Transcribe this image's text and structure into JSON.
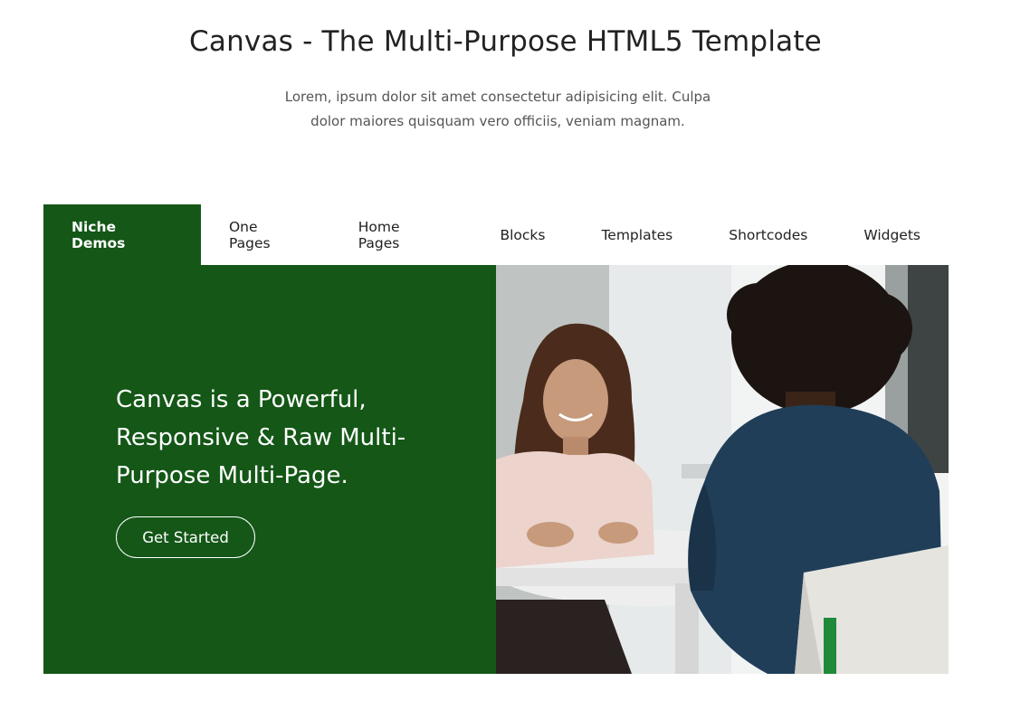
{
  "header": {
    "title": "Canvas - The Multi-Purpose HTML5 Template",
    "subtitle": "Lorem, ipsum dolor sit amet consectetur adipisicing elit. Culpa dolor maiores quisquam vero officiis, veniam magnam."
  },
  "tabs": [
    {
      "label": "Niche Demos",
      "active": true
    },
    {
      "label": "One Pages",
      "active": false
    },
    {
      "label": "Home Pages",
      "active": false
    },
    {
      "label": "Blocks",
      "active": false
    },
    {
      "label": "Templates",
      "active": false
    },
    {
      "label": "Shortcodes",
      "active": false
    },
    {
      "label": "Widgets",
      "active": false
    }
  ],
  "panel": {
    "title": "Canvas is a Powerful, Responsive & Raw Multi-Purpose Multi-Page.",
    "cta_label": "Get Started",
    "image_subject": "two-women-conversation-photo"
  },
  "colors": {
    "accent": "#145717",
    "text": "#222222",
    "muted": "#555555",
    "background": "#ffffff"
  }
}
